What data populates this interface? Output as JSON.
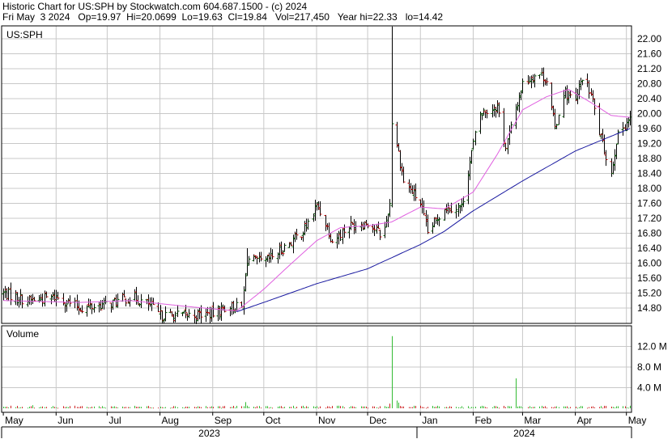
{
  "header": {
    "line1": "Historic Chart for US:SPH by Stockwatch.com 604.687.1500 - (c) 2024",
    "line2": "Fri May  3 2024   Op=19.97  Hi=20.0699  Lo=19.63  Cl=19.84   Vol=217,450   Year hi=22.33   lo=14.42"
  },
  "price_panel": {
    "symbol_label": "US:SPH"
  },
  "volume_panel": {
    "label": "Volume"
  },
  "colors": {
    "bar_up": "#006400",
    "bar_down": "#cc0000",
    "ma_short": "#e060e0",
    "ma_long": "#1a1aa0",
    "volume_up": "#33bb33",
    "volume_down": "#cc2222",
    "grid": "#c8c8c8"
  },
  "chart_data": [
    {
      "type": "bar",
      "subtype": "ohlc",
      "symbol": "US:SPH",
      "y_axis_side": "right",
      "ylim": [
        14.42,
        22.33
      ],
      "yticks": [
        "14.80",
        "15.20",
        "15.60",
        "16.00",
        "16.40",
        "16.80",
        "17.20",
        "17.60",
        "18.00",
        "18.40",
        "18.80",
        "19.20",
        "19.60",
        "20.00",
        "20.40",
        "20.80",
        "21.20",
        "21.60",
        "22.00"
      ],
      "x_month_labels": [
        "May",
        "Jun",
        "Jul",
        "Aug",
        "Sep",
        "Oct",
        "Nov",
        "Dec",
        "Jan",
        "Feb",
        "Mar",
        "Apr",
        "May"
      ],
      "x_year_labels": [
        "2023",
        "2024"
      ],
      "grid": true,
      "close_anchors": [
        {
          "date": "2023-05-01",
          "close": 15.2
        },
        {
          "date": "2023-05-15",
          "close": 15.0
        },
        {
          "date": "2023-06-01",
          "close": 15.1
        },
        {
          "date": "2023-06-15",
          "close": 14.8
        },
        {
          "date": "2023-07-01",
          "close": 14.9
        },
        {
          "date": "2023-07-15",
          "close": 15.1
        },
        {
          "date": "2023-07-25",
          "close": 14.9
        },
        {
          "date": "2023-08-01",
          "close": 14.6
        },
        {
          "date": "2023-08-15",
          "close": 14.6
        },
        {
          "date": "2023-09-01",
          "close": 14.65
        },
        {
          "date": "2023-09-10",
          "close": 14.85
        },
        {
          "date": "2023-09-18",
          "close": 14.8
        },
        {
          "date": "2023-09-21",
          "close": 16.1
        },
        {
          "date": "2023-10-01",
          "close": 16.0
        },
        {
          "date": "2023-10-15",
          "close": 16.5
        },
        {
          "date": "2023-10-25",
          "close": 16.9
        },
        {
          "date": "2023-11-01",
          "close": 17.55
        },
        {
          "date": "2023-11-05",
          "close": 17.2
        },
        {
          "date": "2023-11-10",
          "close": 16.6
        },
        {
          "date": "2023-11-20",
          "close": 17.0
        },
        {
          "date": "2023-12-01",
          "close": 17.1
        },
        {
          "date": "2023-12-10",
          "close": 16.7
        },
        {
          "date": "2023-12-14",
          "close": 17.6
        },
        {
          "date": "2023-12-15",
          "close": 19.8
        },
        {
          "date": "2023-12-18",
          "close": 19.2
        },
        {
          "date": "2023-12-22",
          "close": 18.2
        },
        {
          "date": "2024-01-01",
          "close": 17.6
        },
        {
          "date": "2024-01-05",
          "close": 16.8
        },
        {
          "date": "2024-01-15",
          "close": 17.5
        },
        {
          "date": "2024-01-25",
          "close": 17.5
        },
        {
          "date": "2024-02-01",
          "close": 19.2
        },
        {
          "date": "2024-02-05",
          "close": 20.0
        },
        {
          "date": "2024-02-15",
          "close": 20.2
        },
        {
          "date": "2024-02-20",
          "close": 19.1
        },
        {
          "date": "2024-03-01",
          "close": 20.8
        },
        {
          "date": "2024-03-10",
          "close": 21.1
        },
        {
          "date": "2024-03-15",
          "close": 20.9
        },
        {
          "date": "2024-03-20",
          "close": 19.6
        },
        {
          "date": "2024-03-25",
          "close": 20.6
        },
        {
          "date": "2024-04-01",
          "close": 20.3
        },
        {
          "date": "2024-04-05",
          "close": 21.0
        },
        {
          "date": "2024-04-10",
          "close": 20.5
        },
        {
          "date": "2024-04-15",
          "close": 19.5
        },
        {
          "date": "2024-04-22",
          "close": 18.4
        },
        {
          "date": "2024-04-25",
          "close": 19.3
        },
        {
          "date": "2024-05-01",
          "close": 19.8
        },
        {
          "date": "2024-05-03",
          "close": 19.84
        }
      ],
      "spikes": [
        {
          "date": "2023-12-15",
          "high": 22.33
        },
        {
          "date": "2023-09-21",
          "high": 16.4
        }
      ],
      "ma_short_anchors": [
        {
          "date": "2023-05-01",
          "value": 15.0
        },
        {
          "date": "2023-06-15",
          "value": 14.95
        },
        {
          "date": "2023-07-15",
          "value": 15.0
        },
        {
          "date": "2023-08-15",
          "value": 14.85
        },
        {
          "date": "2023-09-15",
          "value": 14.72
        },
        {
          "date": "2023-10-01",
          "value": 15.3
        },
        {
          "date": "2023-10-15",
          "value": 15.9
        },
        {
          "date": "2023-11-01",
          "value": 16.6
        },
        {
          "date": "2023-11-15",
          "value": 16.95
        },
        {
          "date": "2023-12-01",
          "value": 17.0
        },
        {
          "date": "2023-12-15",
          "value": 17.1
        },
        {
          "date": "2024-01-01",
          "value": 17.5
        },
        {
          "date": "2024-01-15",
          "value": 17.45
        },
        {
          "date": "2024-02-01",
          "value": 17.9
        },
        {
          "date": "2024-02-15",
          "value": 18.9
        },
        {
          "date": "2024-03-01",
          "value": 20.1
        },
        {
          "date": "2024-03-15",
          "value": 20.45
        },
        {
          "date": "2024-03-28",
          "value": 20.65
        },
        {
          "date": "2024-04-10",
          "value": 20.3
        },
        {
          "date": "2024-04-22",
          "value": 19.95
        },
        {
          "date": "2024-05-03",
          "value": 19.9
        }
      ],
      "ma_long_anchors": [
        {
          "date": "2023-09-15",
          "value": 14.7
        },
        {
          "date": "2023-10-01",
          "value": 14.95
        },
        {
          "date": "2023-11-01",
          "value": 15.45
        },
        {
          "date": "2023-12-01",
          "value": 15.85
        },
        {
          "date": "2024-01-01",
          "value": 16.5
        },
        {
          "date": "2024-01-15",
          "value": 16.85
        },
        {
          "date": "2024-02-01",
          "value": 17.4
        },
        {
          "date": "2024-03-01",
          "value": 18.2
        },
        {
          "date": "2024-04-01",
          "value": 19.0
        },
        {
          "date": "2024-05-03",
          "value": 19.6
        }
      ]
    },
    {
      "type": "bar",
      "subtype": "volume",
      "ylim": [
        0,
        14000000
      ],
      "yticks": [
        "4.0 M",
        "8.0 M",
        "12.0 M"
      ],
      "baseline_volume_range": [
        100000,
        500000
      ],
      "spikes": [
        {
          "date": "2023-05-18",
          "volume": 600000,
          "direction": "up"
        },
        {
          "date": "2023-06-12",
          "volume": 500000,
          "direction": "down"
        },
        {
          "date": "2023-09-20",
          "volume": 1200000,
          "direction": "up"
        },
        {
          "date": "2023-12-14",
          "volume": 900000,
          "direction": "down"
        },
        {
          "date": "2023-12-15",
          "volume": 14000000,
          "direction": "up"
        },
        {
          "date": "2023-12-18",
          "volume": 1500000,
          "direction": "up"
        },
        {
          "date": "2023-12-19",
          "volume": 1100000,
          "direction": "up"
        },
        {
          "date": "2024-02-26",
          "volume": 5800000,
          "direction": "up"
        }
      ],
      "last": {
        "date": "2024-05-03",
        "volume": 217450
      }
    }
  ]
}
